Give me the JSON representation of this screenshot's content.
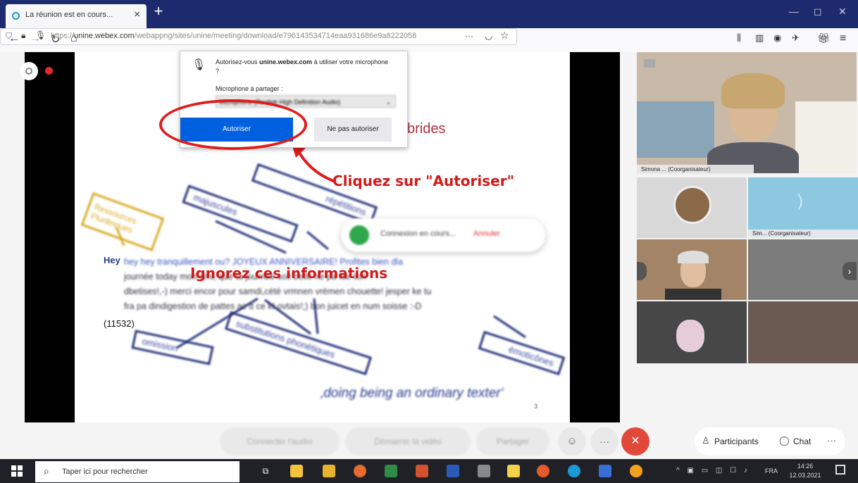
{
  "browser": {
    "tab_title": "La réunion est en cours...",
    "tab_close": "×",
    "new_tab": "+",
    "url_host": "unine.webex.com",
    "url_prefix": "https://",
    "url_rest": "/webappng/sites/unine/meeting/download/e796143534714eaa931686e9a8222058",
    "url_more": "···"
  },
  "permission_popup": {
    "question_pre": "Autorisez-vous ",
    "question_host": "unine.webex.com",
    "question_post": " à utiliser votre microphone ?",
    "mic_label": "Microphone à partager :",
    "mic_value": "Microphone (Realtek High Definition Audio)",
    "allow": "Autoriser",
    "deny": "Ne pas autoriser"
  },
  "annotations": {
    "click_allow": "Cliquez sur \"Autoriser\"",
    "ignore_info": "Ignorez ces informations"
  },
  "slide": {
    "title_fragment": "ybrides",
    "box_ressources": "Ressources Plurilingues",
    "box_majuscules": "majuscules",
    "box_repetition": "répétitions",
    "box_omission": "omission",
    "box_substitutions": "substitutions phonétiques",
    "box_emoticones": "émoticônes",
    "hey": "Hey",
    "msg_line1": "hey hey tranquillement ou? JOYEUX ANNIVERSAIRE! Profites bien dla",
    "msg_line2": "journée today mon ami, que ta journée soit belle ne pa fair ton",
    "msg_line3": "dbetises!,-) merci encor pour samdi,cété vrmnen vrèmen chouette! jesper ke tu",
    "msg_line4": "fra pa dindigestion de pattes ac tt ce kt ovtais!;) bon juicet en num soisse :-D",
    "ref": "(11532)",
    "quote": "‚doing being an ordinary texter‘",
    "page_num": "3",
    "connecting": "Connexion en cours...",
    "cancel": "Annuler"
  },
  "participants": {
    "main_name": "Simona ...",
    "main_role": "(Coorganisateur)",
    "tile2_name": "Sim...",
    "tile2_role": "(Coorganisateur)"
  },
  "toolbar": {
    "audio": "Connecter l'audio",
    "video": "Démarrer la vidéo",
    "share": "Partager",
    "participants": "Participants",
    "chat": "Chat",
    "more": "···"
  },
  "taskbar": {
    "search_placeholder": "Taper ici pour rechercher",
    "lang": "FRA",
    "time": "14:26",
    "date": "12.03.2021"
  }
}
